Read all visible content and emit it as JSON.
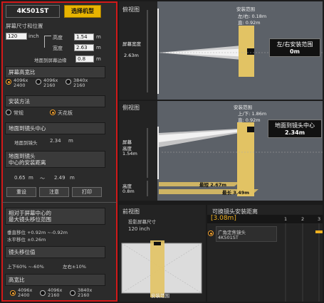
{
  "header": {
    "model": "4K501ST",
    "select_model": "选择机型"
  },
  "screen": {
    "title": "屏幕尺寸和位置",
    "size_value": "120",
    "size_unit": "inch",
    "height_label": "高度",
    "height_value": "1.54",
    "height_unit": "m",
    "width_label": "宽度",
    "width_value": "2.63",
    "width_unit": "m",
    "floor_edge_label": "地面到屏幕边缘",
    "floor_edge_value": "0.8",
    "floor_edge_unit": "m"
  },
  "aspect": {
    "title": "屏幕高宽比",
    "options": [
      {
        "l1": "4096x",
        "l2": "2400"
      },
      {
        "l1": "4096x",
        "l2": "2160"
      },
      {
        "l1": "3840x",
        "l2": "2160"
      }
    ],
    "selected": 0
  },
  "install": {
    "title": "安装方法",
    "normal": "常规",
    "ceiling": "天花板"
  },
  "floor_lens": {
    "title": "地面到镜头中心",
    "label": "地面到镜头",
    "value": "2.34",
    "unit": "m"
  },
  "range": {
    "title_l1": "地面到镜头",
    "title_l2": "中心的安装距离",
    "min": "0.65",
    "min_unit": "m",
    "tilde": "～",
    "max": "2.49",
    "max_unit": "m"
  },
  "buttons": {
    "reset": "重设",
    "note": "注意",
    "print": "打印"
  },
  "shift": {
    "title_l1": "相对于屏幕中心的",
    "title_l2": "最大镜头移位范围",
    "vertical": "垂直移位 +0.92m ~-0.92m",
    "horizontal": "水平移位 ±0.26m",
    "value_title": "镜头移位值",
    "ud": "上下60% ~-60%",
    "lr": "左右±10%"
  },
  "aspect2": {
    "title": "高宽比",
    "options": [
      {
        "l1": "4096x",
        "l2": "2400"
      },
      {
        "l1": "4096x",
        "l2": "2160"
      },
      {
        "l1": "3840x",
        "l2": "2160"
      }
    ]
  },
  "top_view": {
    "title": "俯视图",
    "install_range": "安装范围",
    "lr": "左/右: 0.18m",
    "v": "直: 0.92m",
    "screen_width": "屏幕宽度",
    "screen_width_val": "2.63m",
    "box_title": "左/右安装范围",
    "box_value": "0m"
  },
  "side_view": {
    "title": "侧视图",
    "install_range": "安装范围",
    "lr": "上/下: 1.86m",
    "v": "直: 0.92m",
    "screen_h1": "屏幕",
    "screen_h2": "高度",
    "screen_h_val": "1.54m",
    "height": "高度",
    "height_val": "0.8m",
    "shortest": "最短 2.67m",
    "longest": "最长 3.49m",
    "box_title": "地面到镜头中心",
    "box_value": "2.34m"
  },
  "front_view": {
    "title": "前视图",
    "screen_size_label": "投影屏幕尺寸",
    "screen_size": "120 inch",
    "install_range": "安装范围"
  },
  "lens_dist": {
    "title": "可换镜头安装距离",
    "value": "[3.08m]",
    "ticks": [
      "1",
      "2",
      "3"
    ],
    "lens_l1": "广角定焦镜头",
    "lens_l2": "4K501ST"
  }
}
